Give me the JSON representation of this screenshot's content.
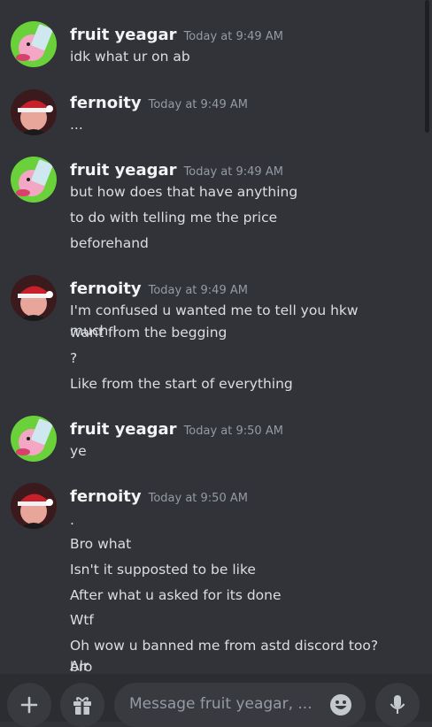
{
  "messages": [
    {
      "author": "fruit yeagar",
      "timestamp": "Today at 9:49 AM",
      "avatar": "kirby-avatar",
      "lines": [
        "idk what ur on ab"
      ]
    },
    {
      "author": "fernoity",
      "timestamp": "Today at 9:49 AM",
      "avatar": "santa-hat-avatar",
      "lines": [
        "..."
      ]
    },
    {
      "author": "fruit yeagar",
      "timestamp": "Today at 9:49 AM",
      "avatar": "kirby-avatar",
      "lines": [
        "but how does that have anything",
        "to do with telling me the price",
        "beforehand"
      ]
    },
    {
      "author": "fernoity",
      "timestamp": "Today at 9:49 AM",
      "avatar": "santa-hat-avatar",
      "lines": [
        "I'm confused u wanted me to tell you hkw much I",
        "want from the begging",
        "?",
        "Like from the start of everything"
      ]
    },
    {
      "author": "fruit yeagar",
      "timestamp": "Today at 9:50 AM",
      "avatar": "kirby-avatar",
      "lines": [
        "ye"
      ]
    },
    {
      "author": "fernoity",
      "timestamp": "Today at 9:50 AM",
      "avatar": "santa-hat-avatar",
      "lines": [
        ".",
        "Bro what",
        "Isn't it supposted to be like",
        "After what u asked for its done",
        "Wtf",
        "Oh wow u banned me from astd discord too? Alr",
        "bro"
      ]
    }
  ],
  "composer": {
    "placeholder": "Message fruit yeagar, ...",
    "icons": [
      "plus-icon",
      "gift-icon",
      "emoji-icon",
      "microphone-icon"
    ]
  },
  "colors": {
    "background": "#313338",
    "composer": "#2b2d31",
    "field": "#383a40",
    "timestamp": "#949ba4"
  }
}
